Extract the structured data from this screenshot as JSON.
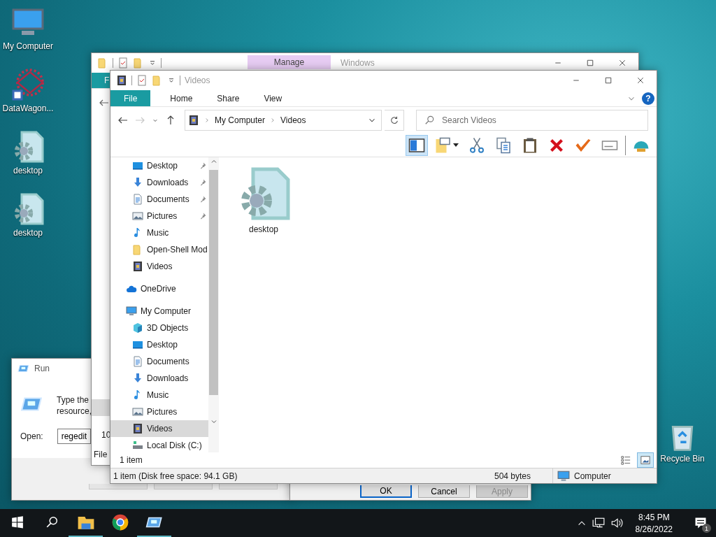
{
  "desktop_icons": [
    {
      "label": "My Computer",
      "kind": "computer"
    },
    {
      "label": "DataWagon...",
      "kind": "shortcut"
    },
    {
      "label": "desktop",
      "kind": "settings-file"
    },
    {
      "label": "desktop",
      "kind": "settings-file"
    }
  ],
  "recycle_bin": {
    "label": "Recycle Bin"
  },
  "run_dialog": {
    "title": "Run",
    "prompt_lines": [
      "Type the",
      "resource,"
    ],
    "open_label": "Open:",
    "open_value": "regedit"
  },
  "properties_dialog": {
    "buttons": [
      {
        "label": "OK",
        "focused": true,
        "disabled": false
      },
      {
        "label": "Cancel",
        "focused": false,
        "disabled": false
      },
      {
        "label": "Apply",
        "focused": false,
        "disabled": true
      }
    ]
  },
  "back_window": {
    "context_tab": "Manage",
    "title": "Windows",
    "ribbon_tab": "F",
    "detail": "10",
    "status": "File"
  },
  "explorer": {
    "title": "Videos",
    "ribbon_tabs": [
      {
        "label": "File",
        "kind": "menu"
      },
      {
        "label": "Home",
        "kind": "tab"
      },
      {
        "label": "Share",
        "kind": "tab"
      },
      {
        "label": "View",
        "kind": "tab"
      }
    ],
    "nav_buttons": [
      {
        "kind": "back",
        "disabled": false
      },
      {
        "kind": "forward",
        "disabled": true
      },
      {
        "kind": "recent",
        "disabled": false
      },
      {
        "kind": "up",
        "disabled": false
      }
    ],
    "help_glyph": "?",
    "path": [
      "My Computer",
      "Videos"
    ],
    "search_placeholder": "Search Videos",
    "toolbar": [
      {
        "kind": "pane",
        "selected": true
      },
      {
        "kind": "new-folder",
        "selected": false
      },
      {
        "kind": "cut",
        "selected": false
      },
      {
        "kind": "copy",
        "selected": false
      },
      {
        "kind": "paste",
        "selected": false
      },
      {
        "kind": "delete",
        "selected": false
      },
      {
        "kind": "check",
        "selected": false
      },
      {
        "kind": "rename",
        "selected": false
      },
      {
        "kind": "shell",
        "selected": false
      }
    ],
    "quick_access": [
      {
        "label": "Desktop",
        "kind": "desktop",
        "pinned": true,
        "selected": false
      },
      {
        "label": "Downloads",
        "kind": "downloads",
        "pinned": true,
        "selected": false
      },
      {
        "label": "Documents",
        "kind": "documents",
        "pinned": true,
        "selected": false
      },
      {
        "label": "Pictures",
        "kind": "pictures",
        "pinned": true,
        "selected": false
      },
      {
        "label": "Music",
        "kind": "music",
        "pinned": false,
        "selected": false
      },
      {
        "label": "Open-Shell Mod",
        "kind": "folder",
        "pinned": false,
        "selected": false
      },
      {
        "label": "Videos",
        "kind": "videos",
        "pinned": false,
        "selected": false
      }
    ],
    "tree": [
      {
        "label": "OneDrive",
        "kind": "onedrive",
        "selected": false
      },
      {
        "label": "My Computer",
        "kind": "computer",
        "selected": false,
        "children": [
          {
            "label": "3D Objects",
            "kind": "cube",
            "selected": false
          },
          {
            "label": "Desktop",
            "kind": "desktop",
            "selected": false
          },
          {
            "label": "Documents",
            "kind": "documents",
            "selected": false
          },
          {
            "label": "Downloads",
            "kind": "downloads",
            "selected": false
          },
          {
            "label": "Music",
            "kind": "music",
            "selected": false
          },
          {
            "label": "Pictures",
            "kind": "pictures",
            "selected": false
          },
          {
            "label": "Videos",
            "kind": "videos",
            "selected": true
          },
          {
            "label": "Local Disk (C:)",
            "kind": "disk",
            "selected": false
          }
        ]
      }
    ],
    "files": [
      {
        "name": "desktop",
        "kind": "settings-file",
        "selected": false
      }
    ],
    "item_count": "1 item",
    "views": [
      {
        "kind": "details",
        "selected": false
      },
      {
        "kind": "large-icons",
        "selected": true
      }
    ],
    "status": {
      "summary": "1 item (Disk free space: 94.1 GB)",
      "size": "504 bytes",
      "zone": "Computer"
    }
  },
  "taskbar": {
    "apps": [
      {
        "kind": "explorer",
        "running": true
      },
      {
        "kind": "chrome",
        "running": false
      },
      {
        "kind": "run",
        "running": true
      }
    ],
    "clock": {
      "time": "8:45 PM",
      "date": "8/26/2022"
    },
    "notifications": "1"
  }
}
